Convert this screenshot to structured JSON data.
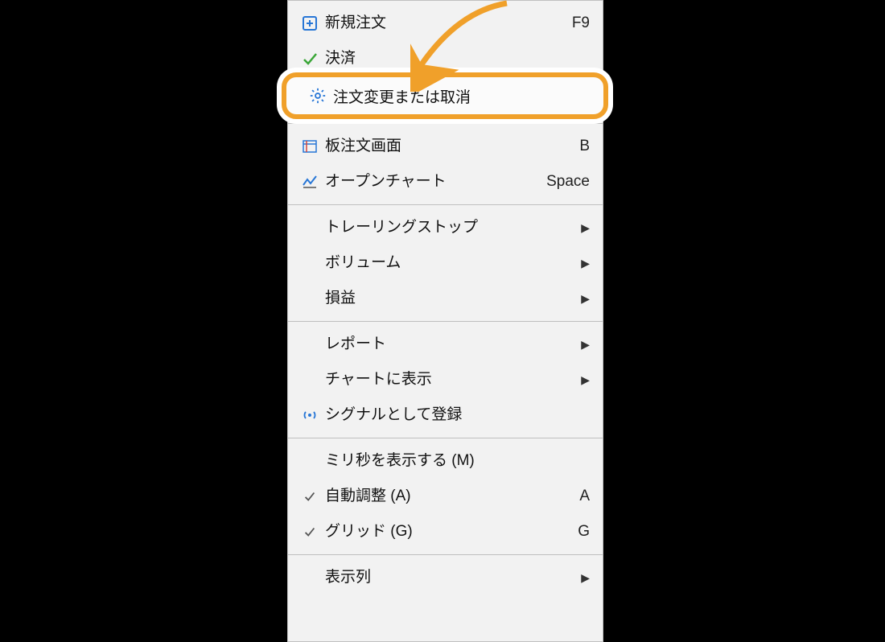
{
  "menu": {
    "items": [
      {
        "id": "new-order",
        "label": "新規注文",
        "shortcut": "F9",
        "icon": "plus-square",
        "submenu": false,
        "checked": false
      },
      {
        "id": "settle",
        "label": "決済",
        "shortcut": "",
        "icon": "check",
        "submenu": false,
        "checked": false
      },
      {
        "id": "modify-cancel",
        "label": "注文変更または取消",
        "shortcut": "",
        "icon": "gear",
        "submenu": false,
        "checked": false,
        "highlight": true
      },
      {
        "id": "sep1",
        "separator": true
      },
      {
        "id": "depth",
        "label": "板注文画面",
        "shortcut": "B",
        "icon": "book",
        "submenu": false,
        "checked": false
      },
      {
        "id": "open-chart",
        "label": "オープンチャート",
        "shortcut": "Space",
        "icon": "chart-line",
        "submenu": false,
        "checked": false
      },
      {
        "id": "sep2",
        "separator": true
      },
      {
        "id": "trailing",
        "label": "トレーリングストップ",
        "shortcut": "",
        "icon": "",
        "submenu": true,
        "checked": false
      },
      {
        "id": "volume",
        "label": "ボリューム",
        "shortcut": "",
        "icon": "",
        "submenu": true,
        "checked": false
      },
      {
        "id": "pnl",
        "label": "損益",
        "shortcut": "",
        "icon": "",
        "submenu": true,
        "checked": false
      },
      {
        "id": "sep3",
        "separator": true
      },
      {
        "id": "report",
        "label": "レポート",
        "shortcut": "",
        "icon": "",
        "submenu": true,
        "checked": false
      },
      {
        "id": "show-chart",
        "label": "チャートに表示",
        "shortcut": "",
        "icon": "",
        "submenu": true,
        "checked": false
      },
      {
        "id": "reg-signal",
        "label": "シグナルとして登録",
        "shortcut": "",
        "icon": "signal",
        "submenu": false,
        "checked": false
      },
      {
        "id": "sep4",
        "separator": true
      },
      {
        "id": "show-ms",
        "label": "ミリ秒を表示する (M)",
        "shortcut": "",
        "icon": "",
        "submenu": false,
        "checked": false
      },
      {
        "id": "auto-arrange",
        "label": "自動調整 (A)",
        "shortcut": "A",
        "icon": "check-mark",
        "submenu": false,
        "checked": true
      },
      {
        "id": "grid",
        "label": "グリッド (G)",
        "shortcut": "G",
        "icon": "check-mark",
        "submenu": false,
        "checked": true
      },
      {
        "id": "sep5",
        "separator": true
      },
      {
        "id": "columns",
        "label": "表示列",
        "shortcut": "",
        "icon": "",
        "submenu": true,
        "checked": false
      }
    ]
  },
  "annotation": {
    "type": "arrow",
    "target": "modify-cancel",
    "color": "#f0a02a"
  }
}
